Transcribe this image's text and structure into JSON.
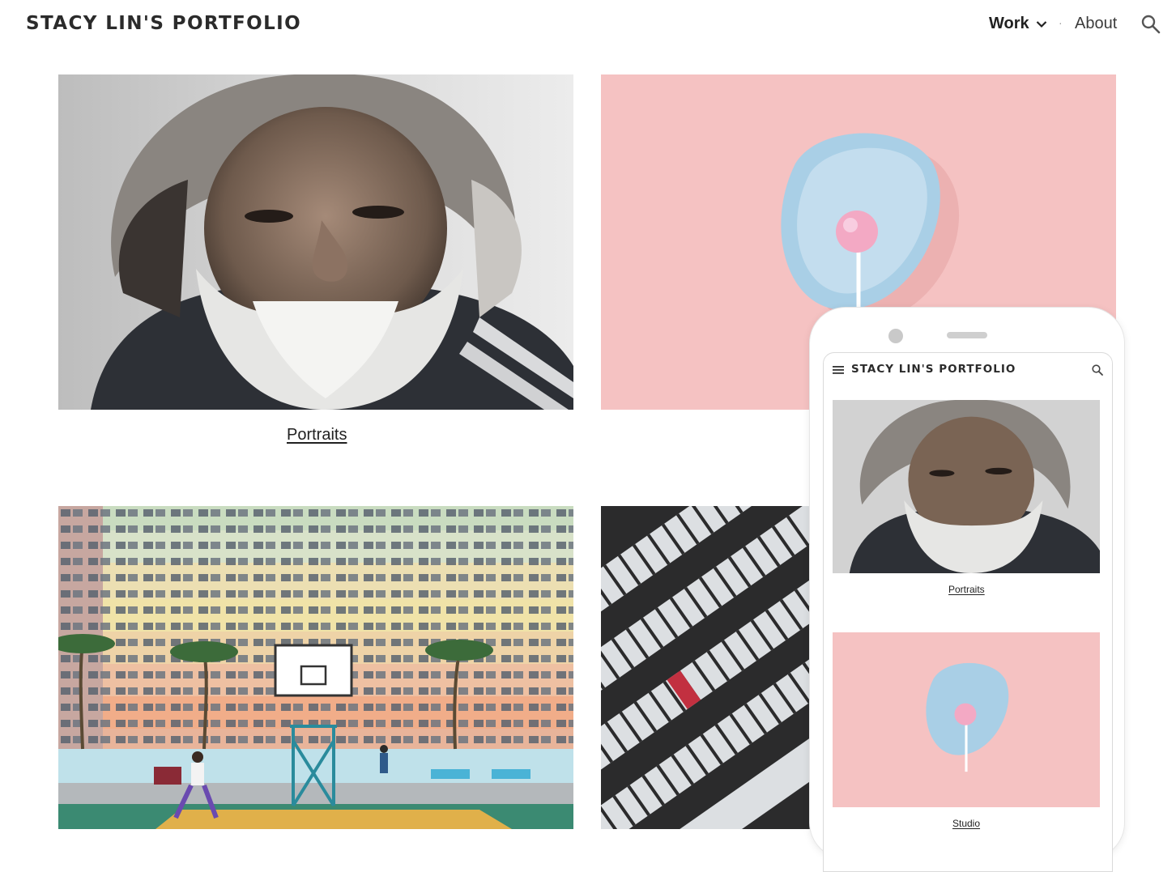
{
  "site": {
    "title": "STACY LIN'S PORTFOLIO"
  },
  "nav": {
    "work_label": "Work",
    "separator": "·",
    "about_label": "About"
  },
  "gallery": {
    "captions": {
      "portraits": "Portraits"
    }
  },
  "mobile_preview": {
    "title": "STACY LIN'S PORTFOLIO",
    "captions": {
      "portraits": "Portraits",
      "studio": "Studio"
    }
  },
  "colors": {
    "studio_pink": "#f5c2c2",
    "plate_blue": "#a9cfe6",
    "lollipop_pink": "#f3a9c4",
    "text_dark": "#212121"
  }
}
